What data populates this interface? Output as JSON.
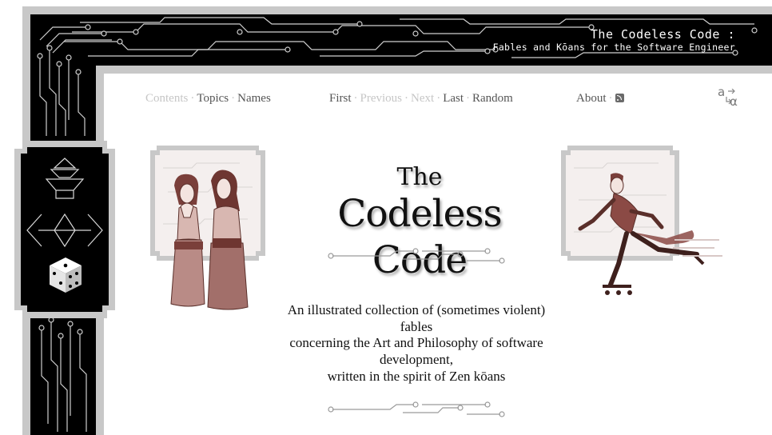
{
  "banner": {
    "title": "The Codeless Code :",
    "subtitle": "Fables and Kōans for the Software Engineer"
  },
  "nav": {
    "contents": "Contents",
    "topics": "Topics",
    "names": "Names",
    "first": "First",
    "previous": "Previous",
    "next": "Next",
    "last": "Last",
    "random": "Random",
    "about": "About",
    "separator": "·"
  },
  "language_icon": {
    "latin": "a",
    "greek": "α"
  },
  "title": {
    "line1": "The",
    "line2": "Codeless Code"
  },
  "tagline": [
    "An illustrated collection of (sometimes violent)",
    "fables",
    "concerning the Art and Philosophy of software",
    "development,",
    "written in the spirit of Zen kōans"
  ],
  "colors": {
    "frame_gray": "#c8c8c8",
    "frame_black": "#000000",
    "nav_text": "#555555",
    "nav_disabled": "#c6c6c6",
    "illustration_tint": "#8a4a4a"
  }
}
